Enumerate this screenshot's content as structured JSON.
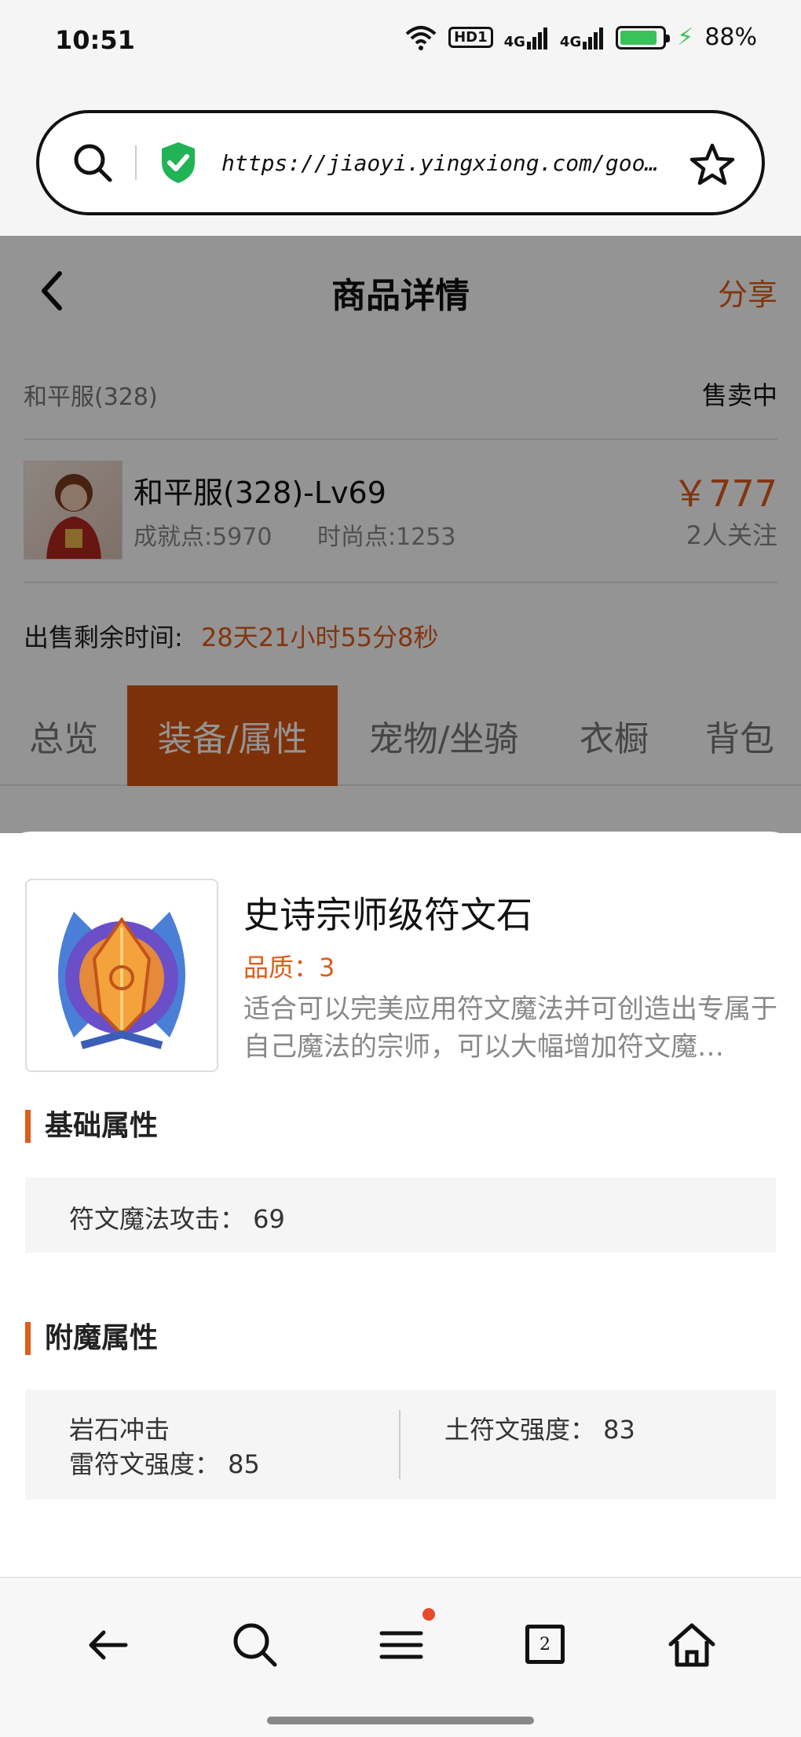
{
  "status_bar": {
    "time": "10:51",
    "hd": "HD1",
    "sig1": "4G",
    "sig2": "4G",
    "battery": "88%"
  },
  "browser": {
    "url": "https://jiaoyi.yingxiong.com/goods/43…",
    "tab_count": "2"
  },
  "header": {
    "title": "商品详情",
    "share": "分享"
  },
  "listing": {
    "server": "和平服(328)",
    "status": "售卖中",
    "character": {
      "name": "和平服(328)-Lv69",
      "achievement": "成就点:5970",
      "fashion": "时尚点:1253",
      "price": "￥777",
      "followers": "2人关注"
    },
    "time_label": "出售剩余时间:",
    "time_value": "28天21小时55分8秒"
  },
  "tabs": [
    {
      "label": "总览"
    },
    {
      "label": "装备/属性"
    },
    {
      "label": "宠物/坐骑"
    },
    {
      "label": "衣橱"
    },
    {
      "label": "背包"
    }
  ],
  "item": {
    "name": "史诗宗师级符文石",
    "quality": "品质：3",
    "description": "适合可以完美应用符文魔法并可创造出专属于自己魔法的宗师，可以大幅增加符文魔…",
    "base_title": "基础属性",
    "base_stat": "符文魔法攻击： 69",
    "enchant_title": "附魔属性",
    "enchant_line1": "岩石冲击",
    "enchant_line2": "雷符文强度： 85",
    "enchant_right": "土符文强度： 83"
  },
  "colors": {
    "accent": "#e05c1a",
    "active_tab": "#d7550f",
    "battery": "#39c25a"
  }
}
